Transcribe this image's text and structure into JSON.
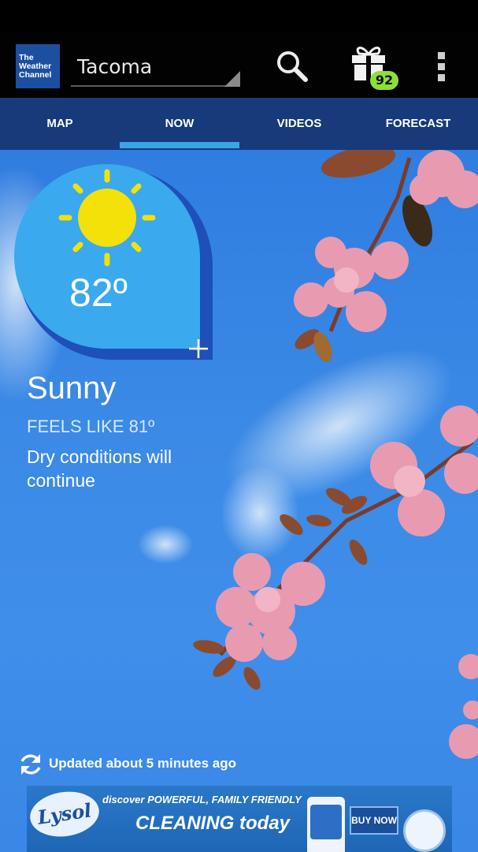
{
  "app": {
    "logo_lines": [
      "The",
      "Weather",
      "Channel"
    ],
    "location": "Tacoma",
    "gift_badge_count": "92"
  },
  "tabs": [
    {
      "label": "MAP",
      "selected": false
    },
    {
      "label": "NOW",
      "selected": true
    },
    {
      "label": "VIDEOS",
      "selected": false
    },
    {
      "label": "FORECAST",
      "selected": false
    }
  ],
  "current": {
    "icon": "sun-icon",
    "temperature": "82º",
    "condition": "Sunny",
    "feels_like": "FEELS LIKE 81º",
    "description": "Dry conditions will continue"
  },
  "status": {
    "updated": "Updated about 5 minutes ago"
  },
  "ad": {
    "brand": "Lysol",
    "line1": "discover POWERFUL, FAMILY FRIENDLY",
    "line2": "CLEANING today",
    "cta": "BUY NOW"
  },
  "colors": {
    "tab_bar": "#163a7a",
    "tab_indicator": "#39a6e4",
    "sky": "#3b8ae6",
    "badge_circle": "#3aa9ee",
    "badge_shadow": "#1f4fb8",
    "sun": "#f4e10a",
    "gift_badge": "#8dde3a"
  }
}
